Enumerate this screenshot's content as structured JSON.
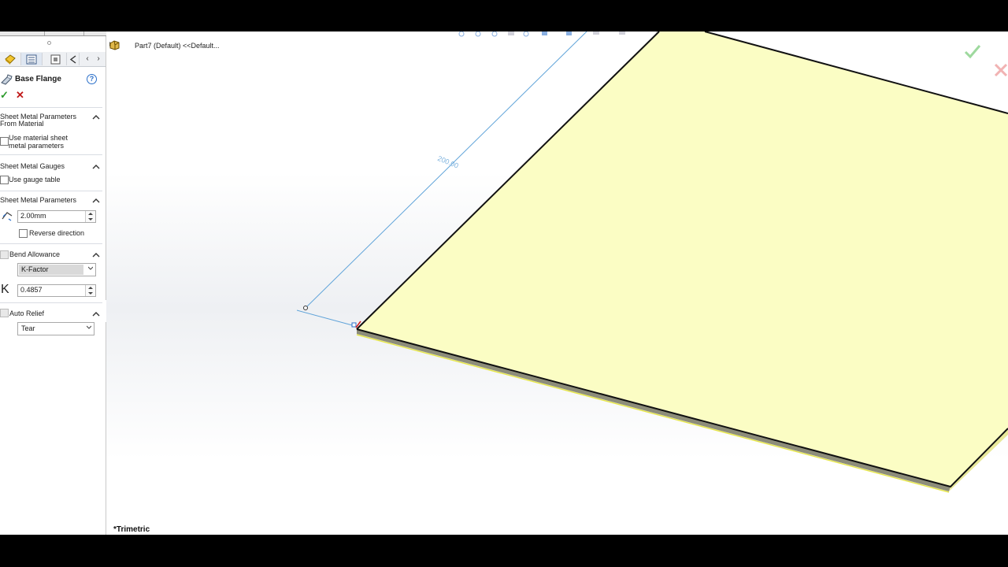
{
  "tree": {
    "item": "Part7 (Default) <<Default..."
  },
  "panel": {
    "title": "Base Flange",
    "help": "?",
    "ok": "✓",
    "cancel": "✕",
    "sections": {
      "from_material": {
        "header_line1": "Sheet Metal Parameters",
        "header_line2": "From Material",
        "checkbox_line1": "Use material sheet",
        "checkbox_line2": "metal parameters"
      },
      "gauges": {
        "header": "Sheet Metal Gauges",
        "checkbox": "Use gauge table"
      },
      "parameters": {
        "header": "Sheet Metal Parameters",
        "thickness": "2.00mm",
        "reverse": "Reverse direction"
      },
      "bend_allowance": {
        "header": "Bend Allowance",
        "type": "K-Factor",
        "k_symbol": "K",
        "k_value": "0.4857"
      },
      "auto_relief": {
        "header": "Auto Relief",
        "type": "Tear"
      }
    }
  },
  "viewport": {
    "dimension": "200.00",
    "view_name": "*Trimetric"
  },
  "colors": {
    "sheet": "#fbfdc4",
    "edge": "#111111",
    "dimension": "#5fa3d9",
    "ok": "#2c9a2c",
    "cancel": "#c01818"
  },
  "icons": [
    "sheet-metal-icon",
    "feature-manager-icon",
    "property-manager-icon",
    "configuration-icon",
    "base-flange-icon",
    "thickness-icon",
    "part-icon"
  ]
}
